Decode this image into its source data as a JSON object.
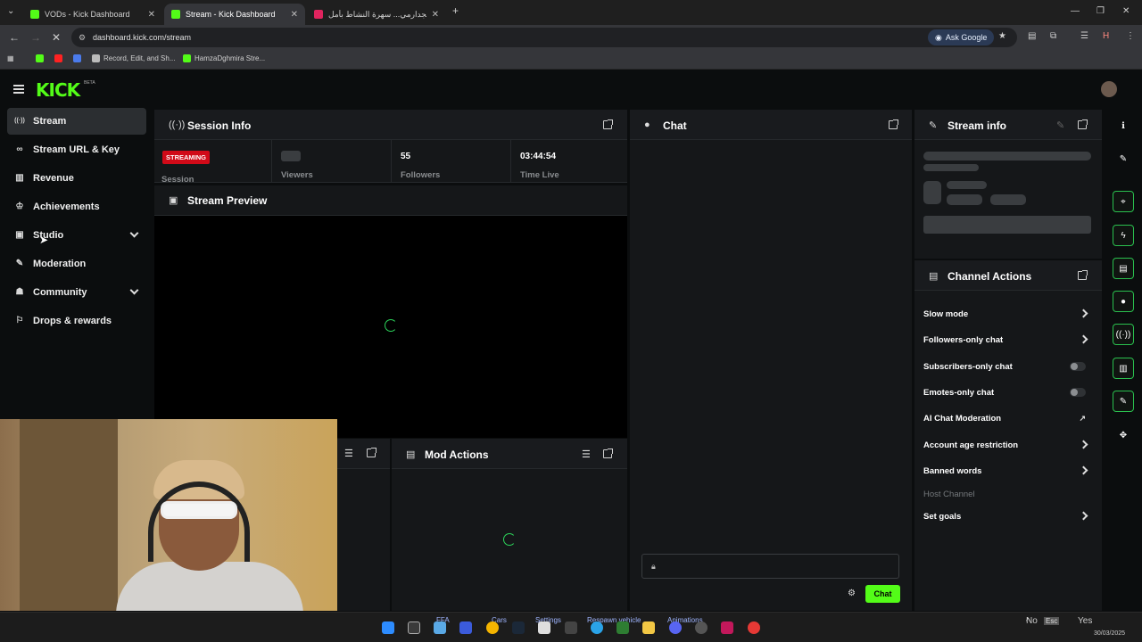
{
  "browser": {
    "tabs": [
      {
        "label": "VODs - Kick Dashboard",
        "color": "#53fc18"
      },
      {
        "label": "Stream - Kick Dashboard",
        "color": "#53fc18"
      },
      {
        "label": "واالجدارمي... سهرة النشاط بأمل",
        "color": "#e0245e"
      }
    ],
    "new_tab": "+",
    "url": "dashboard.kick.com/stream",
    "ask_google": "Ask Google",
    "bookmarks": [
      "Record, Edit, and Sh...",
      "HamzaDghmira Stre..."
    ]
  },
  "app": {
    "logo": "KICK",
    "logo_beta": "BETA"
  },
  "sidebar": {
    "items": [
      {
        "label": "Stream",
        "icon": "broadcast-icon",
        "glyph": "((·))"
      },
      {
        "label": "Stream URL & Key",
        "icon": "link-icon",
        "glyph": "∞"
      },
      {
        "label": "Revenue",
        "icon": "chart-icon",
        "glyph": "▥"
      },
      {
        "label": "Achievements",
        "icon": "trophy-icon",
        "glyph": "♔"
      },
      {
        "label": "Studio",
        "icon": "studio-icon",
        "glyph": "▣"
      },
      {
        "label": "Moderation",
        "icon": "wrench-icon",
        "glyph": "✎"
      },
      {
        "label": "Community",
        "icon": "community-icon",
        "glyph": "☗"
      },
      {
        "label": "Drops & rewards",
        "icon": "gift-icon",
        "glyph": "⚐"
      }
    ]
  },
  "session": {
    "title": "Session Info",
    "status_badge": "STREAMING",
    "session_label": "Session",
    "viewers_label": "Viewers",
    "followers_value": "55",
    "followers_label": "Followers",
    "time_value": "03:44:54",
    "time_label": "Time Live"
  },
  "preview": {
    "title": "Stream Preview"
  },
  "mod_actions": {
    "title": "Mod Actions"
  },
  "chat": {
    "title": "Chat",
    "send_label": "Chat"
  },
  "stream_info": {
    "title": "Stream info"
  },
  "channel_actions": {
    "title": "Channel Actions",
    "items": [
      {
        "label": "Slow mode",
        "control": "arrow"
      },
      {
        "label": "Followers-only chat",
        "control": "arrow"
      },
      {
        "label": "Subscribers-only chat",
        "control": "toggle"
      },
      {
        "label": "Emotes-only chat",
        "control": "toggle"
      },
      {
        "label": "AI Chat Moderation",
        "control": "external"
      },
      {
        "label": "Account age restriction",
        "control": "arrow"
      },
      {
        "label": "Banned words",
        "control": "arrow"
      },
      {
        "label": "Host Channel",
        "control": "none"
      },
      {
        "label": "Set goals",
        "control": "arrow"
      }
    ]
  },
  "taskbar": {
    "labels": [
      "FFA",
      "Cars",
      "Settings",
      "Respawn vehicle",
      "Animations"
    ],
    "tray": [
      "No",
      "Esc",
      "Yes"
    ],
    "date": "30/03/2025"
  },
  "colors": {
    "brand": "#53fc18",
    "live": "#d10a18",
    "accent_green": "#2ac04e"
  }
}
